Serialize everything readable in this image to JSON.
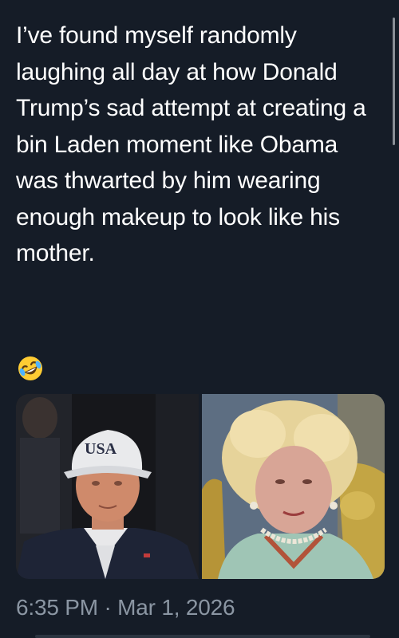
{
  "tweet": {
    "text": "I’ve found myself randomly laughing all day at how Donald Trump’s sad attempt at creating a bin Laden moment like Obama was thwarted by him wearing enough makeup to look like his mother.",
    "emoji": "rolling-on-the-floor-laughing-icon",
    "timestamp": "6:35 PM · Mar 1, 2026"
  },
  "media": {
    "left_photo": {
      "cap_text": "USA"
    }
  },
  "colors": {
    "background": "#151c27",
    "text": "#ffffff",
    "secondary_text": "#8b96a3"
  }
}
